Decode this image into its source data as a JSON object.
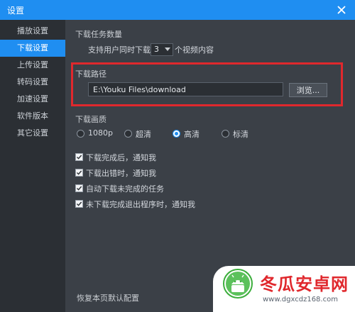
{
  "window": {
    "title": "设置"
  },
  "sidebar": {
    "items": [
      {
        "label": "播放设置"
      },
      {
        "label": "下载设置"
      },
      {
        "label": "上传设置"
      },
      {
        "label": "转码设置"
      },
      {
        "label": "加速设置"
      },
      {
        "label": "软件版本"
      },
      {
        "label": "其它设置"
      }
    ],
    "active_index": 1
  },
  "download_tasks": {
    "section_title": "下载任务数量",
    "prefix": "支持用户同时下载",
    "value": "3",
    "suffix": "个视频内容"
  },
  "download_path": {
    "section_title": "下载路径",
    "value": "E:\\Youku Files\\download",
    "browse_label": "浏览..."
  },
  "quality": {
    "section_title": "下载画质",
    "options": [
      {
        "label": "1080p",
        "checked": false
      },
      {
        "label": "超清",
        "checked": false
      },
      {
        "label": "高清",
        "checked": true
      },
      {
        "label": "标清",
        "checked": false
      }
    ]
  },
  "checkboxes": [
    {
      "label": "下载完成后，通知我",
      "checked": true
    },
    {
      "label": "下载出错时，通知我",
      "checked": true
    },
    {
      "label": "自动下载未完成的任务",
      "checked": true
    },
    {
      "label": "未下载完成退出程序时，通知我",
      "checked": true
    }
  ],
  "footer": {
    "reset_label": "恢复本页默认配置"
  },
  "watermark": {
    "name": "冬瓜安卓网",
    "url": "www.dgxcdz168.com"
  },
  "colors": {
    "accent": "#1f8ef1",
    "highlight": "#e0282d",
    "panel": "#3b4047",
    "sidebar": "#2b2f34"
  }
}
